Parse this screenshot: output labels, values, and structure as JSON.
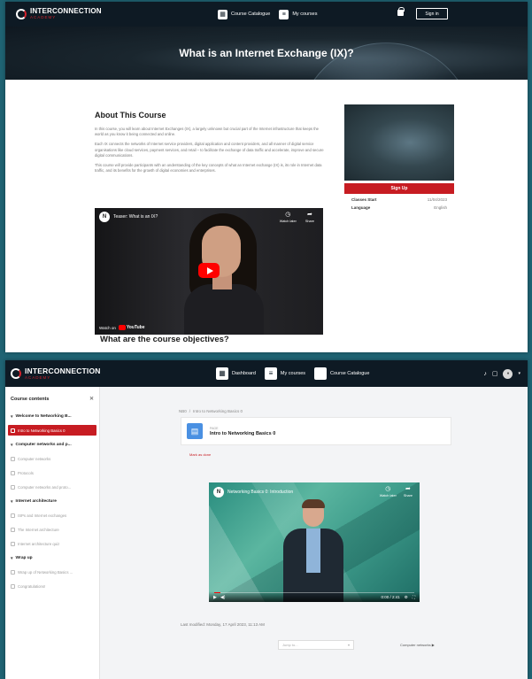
{
  "top": {
    "logo": {
      "main": "INTERCONNECTION",
      "sub": "ACADEMY"
    },
    "nav": {
      "catalogue": "Course Catalogue",
      "my_courses": "My courses",
      "sign_in": "Sign in"
    },
    "hero_title": "What is an Internet Exchange (IX)?",
    "about": {
      "heading": "About This Course",
      "paragraphs": [
        "In this course, you will learn about Internet Exchanges (IX), a largely unknown but crucial part of the Internet infrastructure that keeps the world as you know it being connected and online.",
        "Each IX connects the networks of Internet service providers, digital application and content providers, and all manner of digital service organisations like cloud services, payment services, and retail – to facilitate the exchange of data traffic and accelerate, improve and secure digital communications.",
        "This course will provide participants with an understanding of the key concepts of what an Internet exchange (IX) is, its role in Internet data traffic, and its benefits for the growth of digital economies and enterprises."
      ]
    },
    "video": {
      "title": "Teaser: What is an IX?",
      "watch_later": "Watch later",
      "share": "Share",
      "watch_on": "Watch on",
      "youtube": "YouTube"
    },
    "objectives_heading": "What are the course objectives?",
    "side": {
      "signup": "Sign Up",
      "classes_start_label": "Classes Start",
      "classes_start_value": "11/04/2023",
      "language_label": "Language",
      "language_value": "English"
    }
  },
  "bottom": {
    "logo": {
      "main": "INTERCONNECTION",
      "sub": "ACADEMY"
    },
    "nav": {
      "dashboard": "Dashboard",
      "my_courses": "My courses",
      "catalogue": "Course Catalogue"
    },
    "sidebar": {
      "title": "Course contents",
      "sections": [
        {
          "label": "Welcome to Networking B...",
          "items": [
            {
              "label": "Intro to Networking Basics 0",
              "active": true
            }
          ]
        },
        {
          "label": "Computer networks and p...",
          "items": [
            {
              "label": "Computer networks"
            },
            {
              "label": "Protocols"
            },
            {
              "label": "Computer networks and proto..."
            }
          ]
        },
        {
          "label": "Internet architecture",
          "items": [
            {
              "label": "ISPs and Internet exchanges"
            },
            {
              "label": "The Internet architecture"
            },
            {
              "label": "Internet architecture quiz"
            }
          ]
        },
        {
          "label": "Wrap up",
          "items": [
            {
              "label": "Wrap up of Networking Basics ..."
            },
            {
              "label": "Congratulations!"
            }
          ]
        }
      ]
    },
    "breadcrumb": [
      "NB0",
      "/",
      "Intro to Networking Basics 0"
    ],
    "lesson": {
      "kind": "PAGE",
      "title": "Intro to Networking Basics 0",
      "mark_done": "Mark as done"
    },
    "video": {
      "title": "Networking Basics 0: Introduction",
      "watch_later": "Watch later",
      "share": "Share",
      "time": "0:00 / 2:41",
      "progress": 0.03
    },
    "last_modified": "Last modified: Monday, 17 April 2023, 11:13 AM",
    "jump_placeholder": "Jump to...",
    "next_link": "Computer networks ▶"
  }
}
